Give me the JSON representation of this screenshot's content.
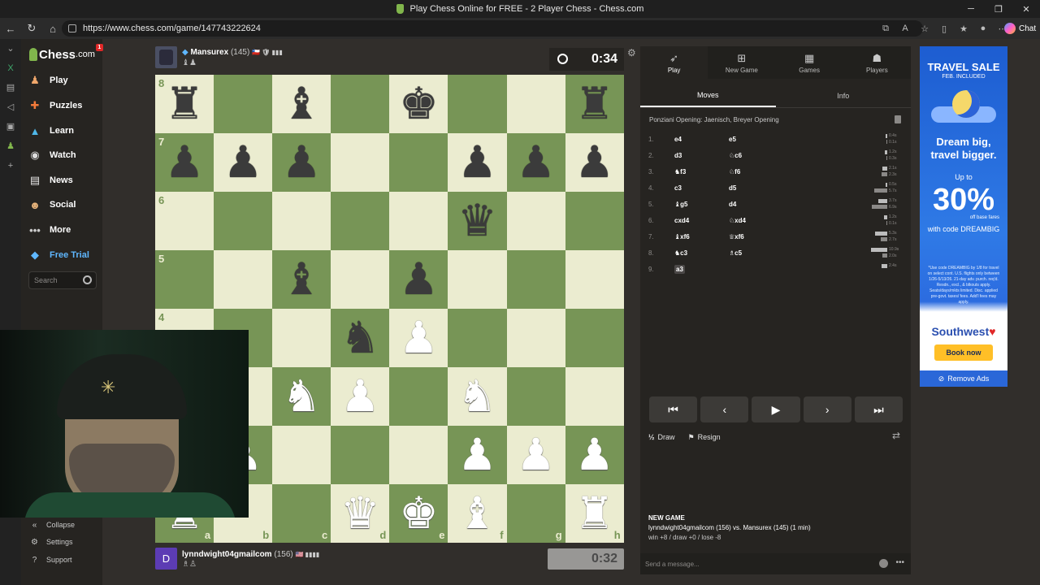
{
  "browser": {
    "window_title": "Play Chess Online for FREE - 2 Player Chess - Chess.com",
    "url": "https://www.chess.com/game/147743222624",
    "chat_label": "Chat"
  },
  "sidebar": {
    "logo_text": "Chess",
    "logo_suffix": ".com",
    "badge": "1",
    "items": [
      {
        "label": "Play",
        "icon": "play-icon"
      },
      {
        "label": "Puzzles",
        "icon": "puzzle-icon"
      },
      {
        "label": "Learn",
        "icon": "learn-icon"
      },
      {
        "label": "Watch",
        "icon": "binoculars-icon"
      },
      {
        "label": "News",
        "icon": "news-icon"
      },
      {
        "label": "Social",
        "icon": "social-icon"
      },
      {
        "label": "More",
        "icon": "more-icon"
      },
      {
        "label": "Free Trial",
        "icon": "diamond-icon"
      }
    ],
    "search_placeholder": "Search",
    "bottom": [
      {
        "label": "Collapse",
        "icon": "collapse-icon"
      },
      {
        "label": "Settings",
        "icon": "gear-icon"
      },
      {
        "label": "Support",
        "icon": "help-icon"
      }
    ],
    "colors": {
      "free_trial": "#5fb7ff",
      "accent": "#81b64c"
    }
  },
  "top_player": {
    "name": "Mansurex",
    "rating": "(145)",
    "flags": "🇨🇱 🛡 ▮▮▮",
    "captured": "♝♟",
    "clock": "0:34"
  },
  "bottom_player": {
    "avatar_letter": "D",
    "name": "lynndwight04gmailcom",
    "rating": "(156)",
    "flags": "🇺🇸 ▮▮▮▮",
    "captured": "♗♙",
    "clock": "0:32"
  },
  "board": {
    "ranks": [
      "8",
      "7",
      "6",
      "5",
      "4",
      "3",
      "2",
      "1"
    ],
    "files": [
      "a",
      "b",
      "c",
      "d",
      "e",
      "f",
      "g",
      "h"
    ],
    "position": [
      [
        "r",
        "",
        "b",
        "",
        "k",
        "",
        "",
        "r"
      ],
      [
        "p",
        "p",
        "p",
        "",
        "",
        "p",
        "p",
        "p"
      ],
      [
        "",
        "",
        "",
        "",
        "",
        "q",
        "",
        ""
      ],
      [
        "",
        "",
        "b",
        "",
        "p",
        "",
        "",
        ""
      ],
      [
        "",
        "",
        "",
        "n",
        "P",
        "",
        "",
        ""
      ],
      [
        "",
        "",
        "N",
        "P",
        "",
        "N",
        "",
        ""
      ],
      [
        "",
        "P",
        "",
        "",
        "",
        "P",
        "P",
        "P"
      ],
      [
        "R",
        "",
        "",
        "Q",
        "K",
        "B",
        "",
        "R"
      ]
    ],
    "light_color": "#ebecd0",
    "dark_color": "#779556"
  },
  "panel": {
    "tabs": [
      {
        "label": "Play",
        "icon": "play-icon"
      },
      {
        "label": "New Game",
        "icon": "plus-icon"
      },
      {
        "label": "Games",
        "icon": "games-icon"
      },
      {
        "label": "Players",
        "icon": "players-icon"
      }
    ],
    "subtabs": [
      "Moves",
      "Info"
    ],
    "opening": "Ponziani Opening: Jaenisch, Breyer Opening",
    "moves": [
      {
        "n": "1.",
        "w": "e4",
        "b": "e5",
        "tw": "0.4s",
        "tb": "0.1s",
        "bw": 2,
        "bb": 1
      },
      {
        "n": "2.",
        "w": "d3",
        "b": "♘c6",
        "tw": "1.2s",
        "tb": "0.3s",
        "bw": 3,
        "bb": 1
      },
      {
        "n": "3.",
        "w": "♞f3",
        "b": "♘f6",
        "tw": "2.1s",
        "tb": "2.3s",
        "bw": 6,
        "bb": 7
      },
      {
        "n": "4.",
        "w": "c3",
        "b": "d5",
        "tw": "0.5s",
        "tb": "5.7s",
        "bw": 2,
        "bb": 16
      },
      {
        "n": "5.",
        "w": "♝g5",
        "b": "d4",
        "tw": "3.7s",
        "tb": "6.9s",
        "bw": 11,
        "bb": 19
      },
      {
        "n": "6.",
        "w": "cxd4",
        "b": "♘xd4",
        "tw": "1.2s",
        "tb": "0.1s",
        "bw": 4,
        "bb": 1
      },
      {
        "n": "7.",
        "w": "♝xf6",
        "b": "♕xf6",
        "tw": "5.3s",
        "tb": "2.7s",
        "bw": 15,
        "bb": 8
      },
      {
        "n": "8.",
        "w": "♞c3",
        "b": "♗c5",
        "tw": "10.9s",
        "tb": "2.0s",
        "bw": 20,
        "bb": 6
      },
      {
        "n": "9.",
        "w": "a3",
        "b": "",
        "tw": "2.4s",
        "tb": "",
        "bw": 7,
        "bb": 0
      }
    ],
    "actions": {
      "draw_half": "½",
      "draw": "Draw",
      "resign": "Resign"
    },
    "chat": {
      "title": "NEW GAME",
      "line2": "lynndwight04gmailcom (156) vs. Mansurex (145) (1 min)",
      "line3": "win +8 / draw +0 / lose -8",
      "placeholder": "Send a message..."
    }
  },
  "ad": {
    "headline": "TRAVEL SALE",
    "sub": "FEB. INCLUDED",
    "tagline1": "Dream big,",
    "tagline2": "travel bigger.",
    "upto": "Up to",
    "percent": "30%",
    "offbase": "off base fares",
    "code": "with code DREAMBIG",
    "fine": "*Use code DREAMBIG by 1/8 for travel on select cont. U.S. flights only between 1/26-5/13/26. 21-day adv. purch. req'd. Resdn., excl., & blkouts apply. Seats/days/mkts limited. Disc. applied pre-govt. taxes/ fees. Add'l fees may apply.",
    "brand": "Southwest",
    "cta": "Book now",
    "remove": "Remove Ads"
  }
}
